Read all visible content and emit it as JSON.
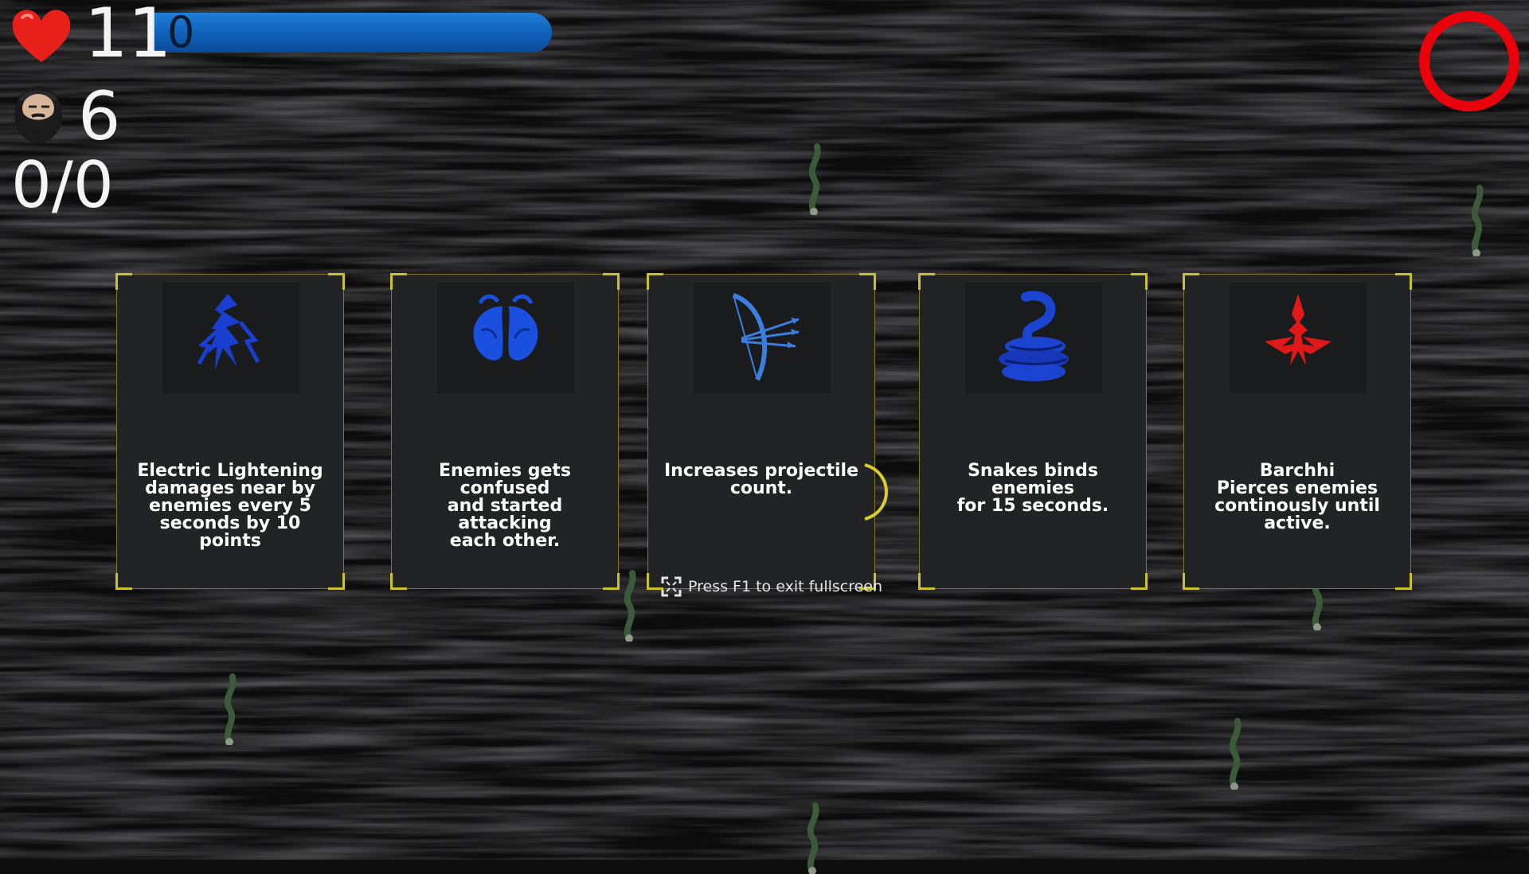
{
  "hud": {
    "health": "11",
    "xp_value": "0",
    "kills": "6",
    "wave": "0/0",
    "colors": {
      "heart": "#e8201a",
      "xp_bar": "#1570c8",
      "ring": "#e8000b"
    }
  },
  "cards": [
    {
      "icon": "lightning-figure-icon",
      "icon_color": "#1a3fd0",
      "text": "Electric Lightening\ndamages near by\nenemies every 5\nseconds by 10 points"
    },
    {
      "icon": "confusion-icon",
      "icon_color": "#1a4fe0",
      "text": "Enemies gets confused\nand started attacking\neach other."
    },
    {
      "icon": "bow-arrows-icon",
      "icon_color": "#3a7fe0",
      "text": "Increases projectile\ncount."
    },
    {
      "icon": "snake-icon",
      "icon_color": "#1a44d0",
      "text": "Snakes binds enemies\nfor 15 seconds."
    },
    {
      "icon": "barchhi-spear-icon",
      "icon_color": "#e01818",
      "text": "Barchhi\nPierces enemies\ncontinously until active."
    }
  ],
  "toast": {
    "text": "Press F1 to exit fullscreen"
  }
}
